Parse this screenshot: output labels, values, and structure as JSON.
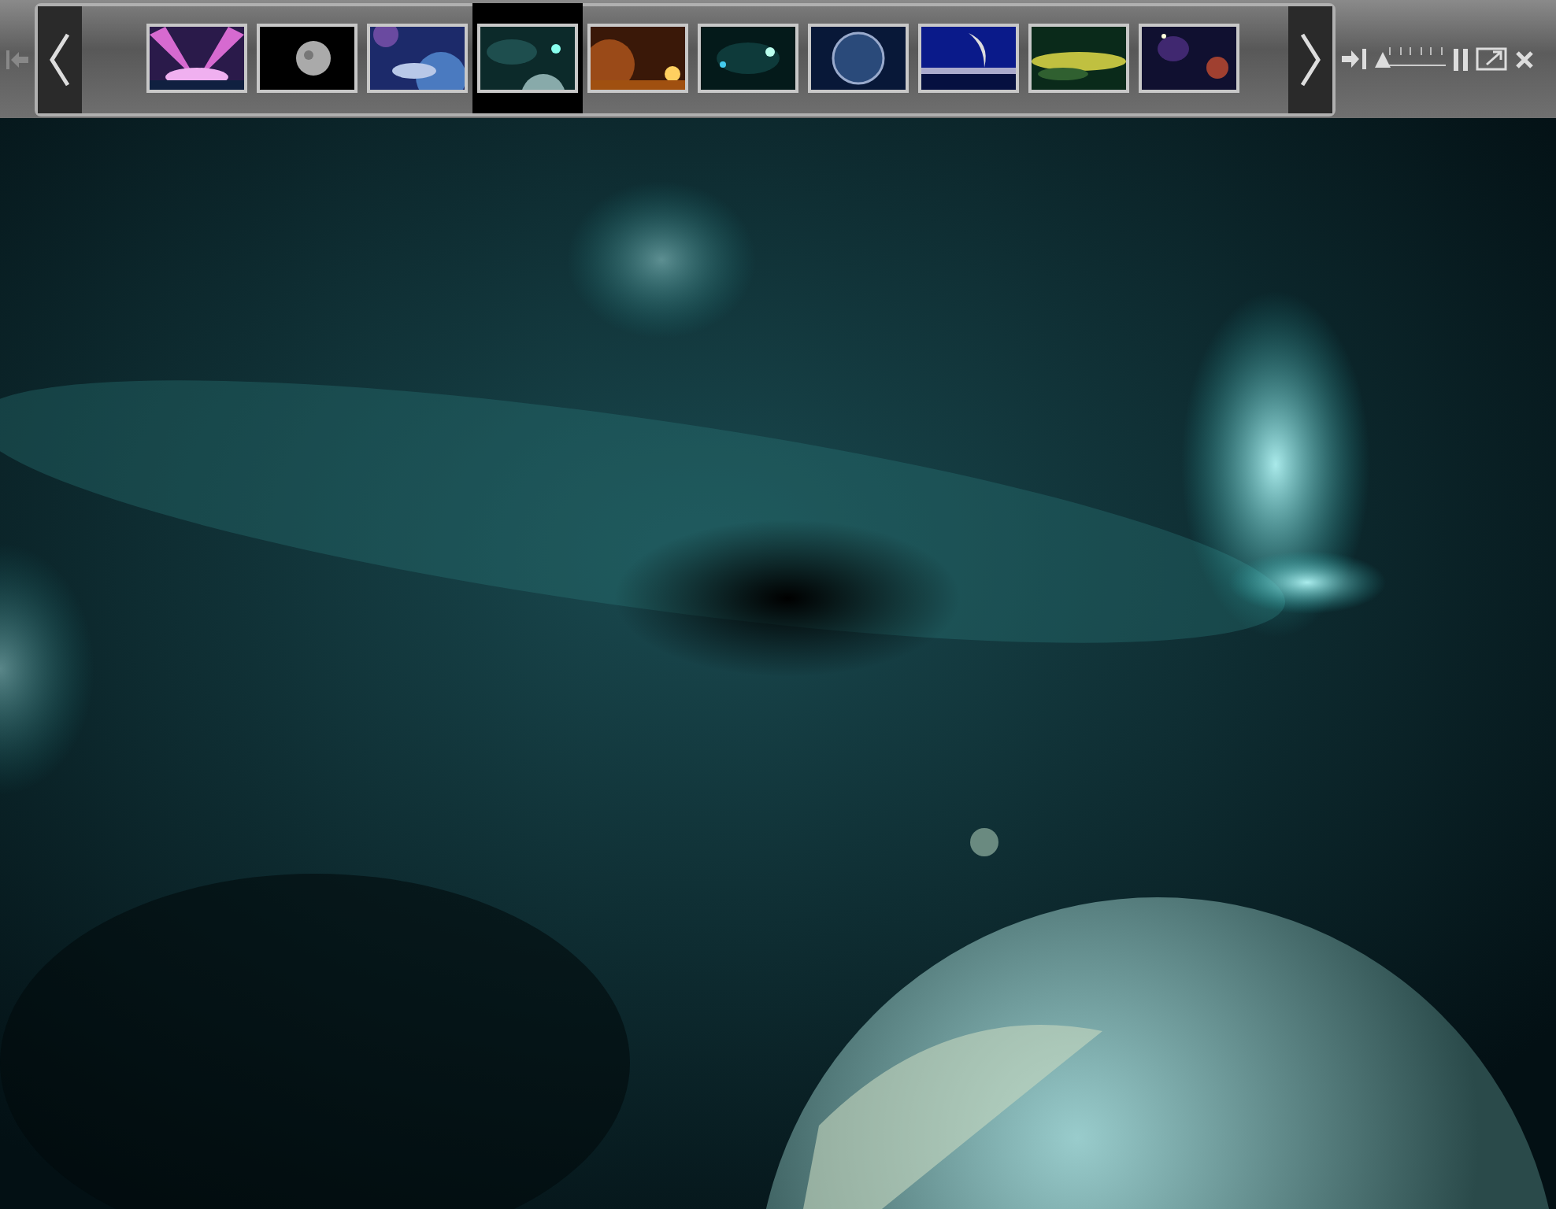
{
  "filmstrip": {
    "thumbnails": [
      {
        "kind": "picture",
        "selected": false
      },
      {
        "kind": "picture",
        "selected": false
      },
      {
        "kind": "picture",
        "selected": false
      },
      {
        "kind": "picture",
        "selected": true
      },
      {
        "kind": "picture",
        "selected": false
      },
      {
        "kind": "picture",
        "selected": false
      },
      {
        "kind": "picture",
        "selected": false
      },
      {
        "kind": "picture",
        "selected": false
      },
      {
        "kind": "picture",
        "selected": false
      },
      {
        "kind": "picture",
        "selected": false
      }
    ]
  },
  "controls": {
    "speed": {
      "level": 0.1
    },
    "playing": true
  },
  "viewer": {
    "kind": "picture"
  }
}
